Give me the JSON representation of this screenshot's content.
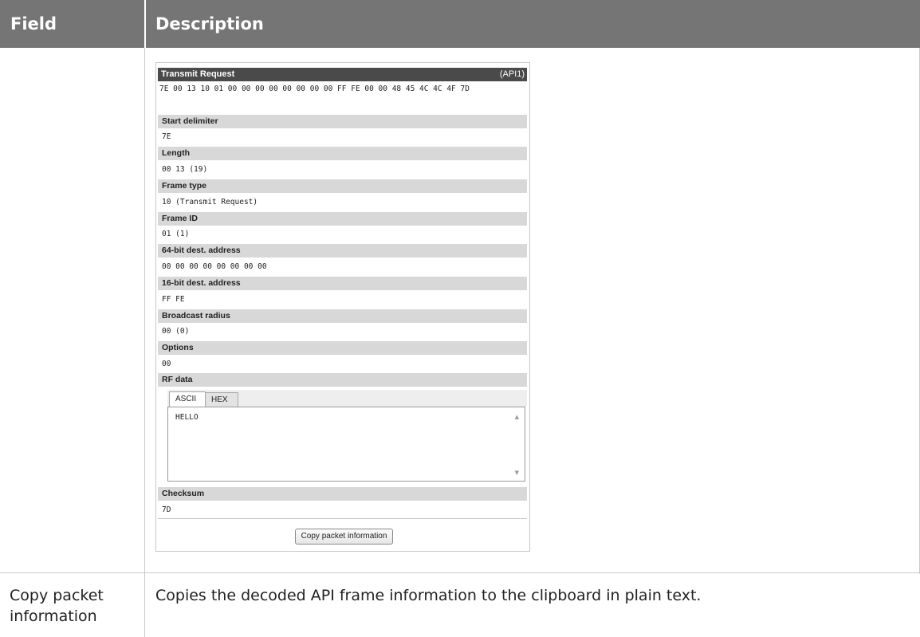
{
  "table": {
    "headers": {
      "field": "Field",
      "description": "Description"
    },
    "row2": {
      "field": "Copy packet information",
      "description": "Copies the decoded API frame information to the clipboard in plain text."
    }
  },
  "panel": {
    "title": "Transmit Request",
    "api": "(API1)",
    "raw_hex": "7E 00 13 10 01 00 00 00 00 00 00 00 00 FF FE 00 00 48 45 4C 4C 4F 7D",
    "fields": [
      {
        "label": "Start delimiter",
        "value": "7E"
      },
      {
        "label": "Length",
        "value": "00 13 (19)"
      },
      {
        "label": "Frame type",
        "value": "10 (Transmit Request)"
      },
      {
        "label": "Frame ID",
        "value": "01 (1)"
      },
      {
        "label": "64-bit dest. address",
        "value": "00 00 00 00 00 00 00 00"
      },
      {
        "label": "16-bit dest. address",
        "value": "FF FE"
      },
      {
        "label": "Broadcast radius",
        "value": "00 (0)"
      },
      {
        "label": "Options",
        "value": "00"
      }
    ],
    "rf_data": {
      "label": "RF data",
      "tabs": [
        "ASCII",
        "HEX"
      ],
      "active_tab": "ASCII",
      "text": "HELLO"
    },
    "checksum": {
      "label": "Checksum",
      "value": "7D"
    },
    "copy_button": "Copy packet information"
  },
  "colors": {
    "header_bg": "#757575",
    "section_bg": "#d8d8d8",
    "panel_title_bg": "#4a4a4a"
  }
}
